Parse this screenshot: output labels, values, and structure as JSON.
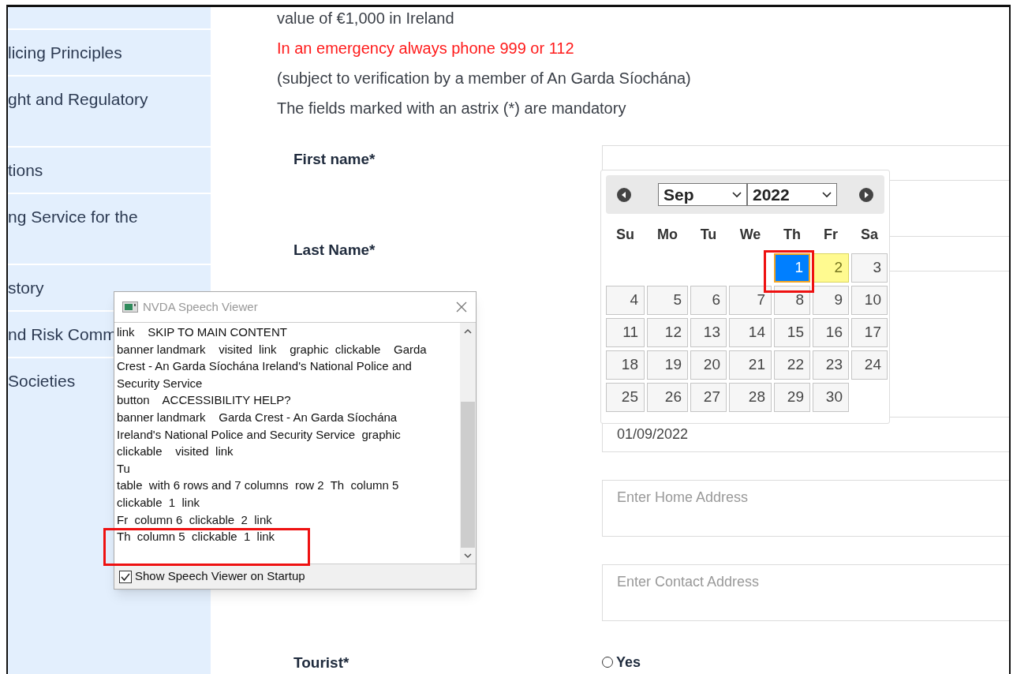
{
  "sidebar": {
    "items": [
      {
        "label": "licing Principles",
        "kind": "single"
      },
      {
        "label": "ght and Regulatory",
        "kind": "double"
      },
      {
        "label": "tions",
        "kind": "single"
      },
      {
        "label": "ng Service for the",
        "kind": "double"
      },
      {
        "label": "story",
        "kind": "single"
      },
      {
        "label": "nd Risk Comm",
        "kind": "single"
      },
      {
        "label": "Societies",
        "kind": "single"
      }
    ]
  },
  "intro": [
    {
      "text": "value of €1,000 in Ireland",
      "kind": "normal"
    },
    {
      "text": "In an emergency always phone 999 or 112",
      "kind": "alert"
    },
    {
      "text": "(subject to verification by a member of An Garda Síochána)",
      "kind": "normal"
    },
    {
      "text": "The fields marked with an astrix (*) are mandatory",
      "kind": "normal"
    }
  ],
  "form": {
    "fields": [
      {
        "label": "First name*",
        "kind": "input"
      },
      {
        "label": "Last Name*",
        "kind": "input"
      },
      {
        "value": "01/09/2022",
        "kind": "input"
      },
      {
        "placeholder": "Enter Home Address",
        "kind": "textarea"
      },
      {
        "placeholder": "Enter Contact Address",
        "kind": "textarea"
      },
      {
        "label": "Tourist*",
        "kind": "radio",
        "option": "Yes",
        "checked": false
      }
    ]
  },
  "datepicker": {
    "month": "Sep",
    "year": "2022",
    "weekdays": [
      "Su",
      "Mo",
      "Tu",
      "We",
      "Th",
      "Fr",
      "Sa"
    ],
    "weeks": [
      [
        {
          "kind": "empty"
        },
        {
          "kind": "empty"
        },
        {
          "kind": "empty"
        },
        {
          "kind": "empty"
        },
        {
          "kind": "day",
          "label": "1",
          "selected": true,
          "highlighted": false
        },
        {
          "kind": "day",
          "label": "2",
          "selected": false,
          "highlighted": true
        },
        {
          "kind": "day",
          "label": "3",
          "selected": false,
          "highlighted": false
        }
      ],
      [
        {
          "kind": "day",
          "label": "4",
          "selected": false,
          "highlighted": false
        },
        {
          "kind": "day",
          "label": "5",
          "selected": false,
          "highlighted": false
        },
        {
          "kind": "day",
          "label": "6",
          "selected": false,
          "highlighted": false
        },
        {
          "kind": "day",
          "label": "7",
          "selected": false,
          "highlighted": false
        },
        {
          "kind": "day",
          "label": "8",
          "selected": false,
          "highlighted": false
        },
        {
          "kind": "day",
          "label": "9",
          "selected": false,
          "highlighted": false
        },
        {
          "kind": "day",
          "label": "10",
          "selected": false,
          "highlighted": false
        }
      ],
      [
        {
          "kind": "day",
          "label": "11",
          "selected": false,
          "highlighted": false
        },
        {
          "kind": "day",
          "label": "12",
          "selected": false,
          "highlighted": false
        },
        {
          "kind": "day",
          "label": "13",
          "selected": false,
          "highlighted": false
        },
        {
          "kind": "day",
          "label": "14",
          "selected": false,
          "highlighted": false
        },
        {
          "kind": "day",
          "label": "15",
          "selected": false,
          "highlighted": false
        },
        {
          "kind": "day",
          "label": "16",
          "selected": false,
          "highlighted": false
        },
        {
          "kind": "day",
          "label": "17",
          "selected": false,
          "highlighted": false
        }
      ],
      [
        {
          "kind": "day",
          "label": "18",
          "selected": false,
          "highlighted": false
        },
        {
          "kind": "day",
          "label": "19",
          "selected": false,
          "highlighted": false
        },
        {
          "kind": "day",
          "label": "20",
          "selected": false,
          "highlighted": false
        },
        {
          "kind": "day",
          "label": "21",
          "selected": false,
          "highlighted": false
        },
        {
          "kind": "day",
          "label": "22",
          "selected": false,
          "highlighted": false
        },
        {
          "kind": "day",
          "label": "23",
          "selected": false,
          "highlighted": false
        },
        {
          "kind": "day",
          "label": "24",
          "selected": false,
          "highlighted": false
        }
      ],
      [
        {
          "kind": "day",
          "label": "25",
          "selected": false,
          "highlighted": false
        },
        {
          "kind": "day",
          "label": "26",
          "selected": false,
          "highlighted": false
        },
        {
          "kind": "day",
          "label": "27",
          "selected": false,
          "highlighted": false
        },
        {
          "kind": "day",
          "label": "28",
          "selected": false,
          "highlighted": false
        },
        {
          "kind": "day",
          "label": "29",
          "selected": false,
          "highlighted": false
        },
        {
          "kind": "day",
          "label": "30",
          "selected": false,
          "highlighted": false
        },
        {
          "kind": "empty"
        }
      ]
    ]
  },
  "speech_viewer": {
    "title": "NVDA Speech Viewer",
    "lines": [
      "link    SKIP TO MAIN CONTENT",
      "banner landmark    visited  link    graphic  clickable    Garda",
      "Crest - An Garda Síochána Ireland's National Police and",
      "Security Service",
      "button    ACCESSIBILITY HELP?",
      "banner landmark    Garda Crest - An Garda Síochána",
      "Ireland's National Police and Security Service  graphic",
      "clickable    visited  link",
      "Tu",
      "table  with 6 rows and 7 columns  row 2  Th  column 5",
      "clickable  1  link",
      "Fr  column 6  clickable  2  link",
      "Th  column 5  clickable  1  link"
    ],
    "startup_checkbox": {
      "label": "Show Speech Viewer on Startup",
      "checked": true
    }
  }
}
